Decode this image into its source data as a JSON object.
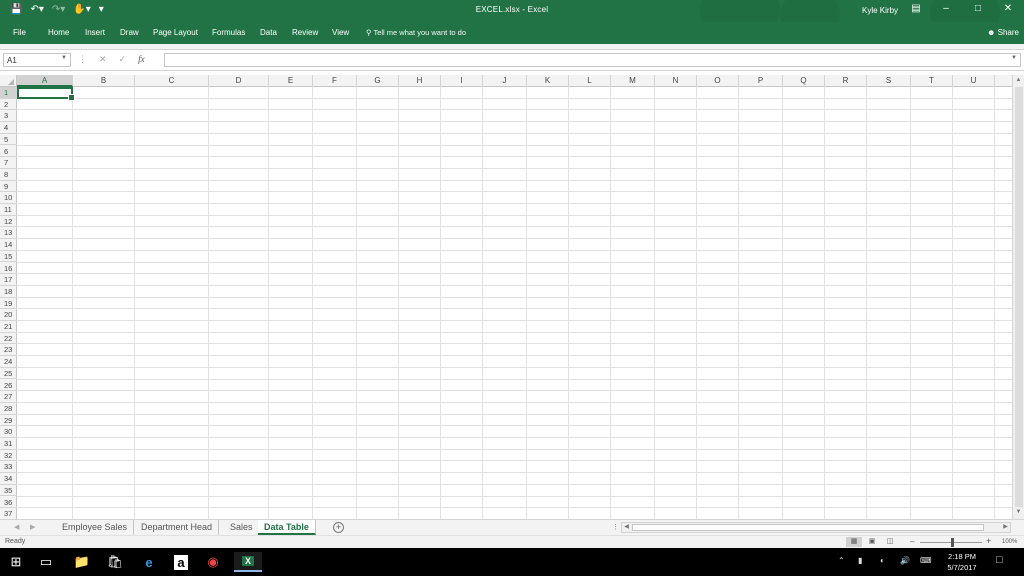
{
  "window": {
    "title": "EXCEL.xlsx - Excel",
    "user": "Kyle Kirby",
    "accent": "#217346"
  },
  "qat": {
    "save_icon": "save-icon",
    "undo_icon": "undo-icon",
    "redo_icon": "redo-icon",
    "touch_icon": "touch-mode-icon",
    "customize_icon": "customize-qat-icon"
  },
  "ribbon": {
    "tabs": [
      "File",
      "Home",
      "Insert",
      "Draw",
      "Page Layout",
      "Formulas",
      "Data",
      "Review",
      "View"
    ],
    "tell_me": "Tell me what you want to do",
    "share": "Share"
  },
  "formula_bar": {
    "name_box": "A1",
    "formula": ""
  },
  "columns": [
    "A",
    "B",
    "C",
    "D",
    "E",
    "F",
    "G",
    "H",
    "I",
    "J",
    "K",
    "L",
    "M",
    "N",
    "O",
    "P",
    "Q",
    "R",
    "S",
    "T",
    "U"
  ],
  "rows": [
    "1",
    "2",
    "3",
    "4",
    "5",
    "6",
    "7",
    "8",
    "9",
    "10",
    "11",
    "12",
    "13",
    "14",
    "15",
    "16",
    "17",
    "18",
    "19",
    "20",
    "21",
    "22",
    "23",
    "24",
    "25",
    "26",
    "27",
    "28",
    "29",
    "30",
    "31",
    "32",
    "33",
    "34",
    "35",
    "36",
    "37"
  ],
  "sheets": [
    {
      "name": "Employee Sales",
      "active": false
    },
    {
      "name": "Department Head",
      "active": false
    },
    {
      "name": "Sales",
      "active": false
    },
    {
      "name": "Data Table",
      "active": true
    }
  ],
  "status": {
    "ready": "Ready",
    "zoom": "100%"
  },
  "taskbar": {
    "time": "2:18 PM",
    "date": "5/7/2017"
  }
}
